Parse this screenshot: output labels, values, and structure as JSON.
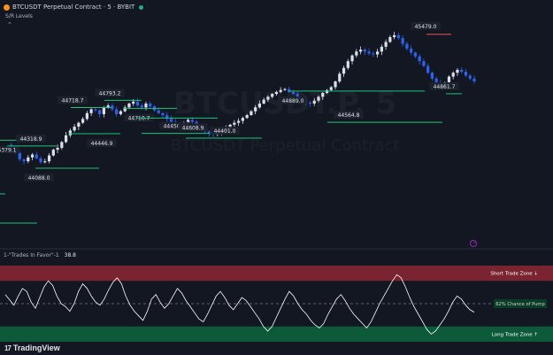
{
  "header": {
    "symbol_title": "BTCUSDT Perpetual Contract · 5 · BYBIT",
    "indicator_name": "S/R Levels"
  },
  "watermark": {
    "line1": "BTCUSDT.P, 5",
    "line2": "BTCUSDT Perpetual Contract"
  },
  "sub_indicator": {
    "name": "1-\"Trades In Favor\"-1",
    "value": "38.8"
  },
  "brand": {
    "name": "TradingView"
  },
  "colors": {
    "background": "#131722",
    "up_candle": "#dbe0f0",
    "down_candle": "#2e62f0",
    "support_line": "#1ec27a",
    "resistance_line": "#ef5350",
    "short_zone": "#7a2331",
    "long_zone": "#0d5a3a",
    "oscillator": "#ffffff"
  },
  "chart_data": {
    "type": "candlestick",
    "price_axis_visible": false,
    "levels": [
      {
        "label": "5379.1",
        "price": 44379.1,
        "kind": "support"
      },
      {
        "label": "44318.9",
        "price": 44318.9,
        "kind": "support"
      },
      {
        "label": "44088.0",
        "price": 44088.0,
        "kind": "support"
      },
      {
        "label": "44718.7",
        "price": 44718.7,
        "kind": "support"
      },
      {
        "label": "44446.9",
        "price": 44446.9,
        "kind": "support"
      },
      {
        "label": "44793.2",
        "price": 44793.2,
        "kind": "support"
      },
      {
        "label": "44710.7",
        "price": 44710.7,
        "kind": "support"
      },
      {
        "label": "44450.3",
        "price": 44450.3,
        "kind": "support"
      },
      {
        "label": "44608.9",
        "price": 44608.9,
        "kind": "support"
      },
      {
        "label": "44401.0",
        "price": 44401.0,
        "kind": "support"
      },
      {
        "label": "44889.0",
        "price": 44889.0,
        "kind": "support"
      },
      {
        "label": "44564.8",
        "price": 44564.8,
        "kind": "support"
      },
      {
        "label": "45479.0",
        "price": 45479.0,
        "kind": "resistance"
      },
      {
        "label": "44861.7",
        "price": 44861.7,
        "kind": "support"
      }
    ],
    "price_path": [
      44330,
      44290,
      44250,
      44180,
      44160,
      44200,
      44230,
      44190,
      44150,
      44160,
      44220,
      44280,
      44300,
      44360,
      44430,
      44480,
      44520,
      44560,
      44600,
      44660,
      44700,
      44690,
      44650,
      44720,
      44740,
      44700,
      44650,
      44680,
      44720,
      44760,
      44780,
      44740,
      44720,
      44760,
      44730,
      44690,
      44660,
      44640,
      44600,
      44570,
      44540,
      44520,
      44560,
      44590,
      44570,
      44540,
      44500,
      44470,
      44450,
      44440,
      44460,
      44480,
      44500,
      44540,
      44560,
      44580,
      44610,
      44640,
      44680,
      44720,
      44760,
      44800,
      44830,
      44860,
      44880,
      44900,
      44910,
      44880,
      44860,
      44820,
      44800,
      44770,
      44760,
      44790,
      44830,
      44870,
      44900,
      44930,
      44990,
      45070,
      45130,
      45200,
      45260,
      45300,
      45320,
      45300,
      45280,
      45270,
      45300,
      45350,
      45400,
      45450,
      45470,
      45440,
      45380,
      45330,
      45290,
      45250,
      45200,
      45150,
      45080,
      45020,
      44970,
      44940,
      44980,
      45040,
      45080,
      45110,
      45090,
      45050,
      45020,
      44990
    ],
    "oscillator": {
      "name": "Trades In Favor",
      "current_value": 38.8,
      "range": [
        0,
        100
      ],
      "zones": [
        {
          "label": "Short Trade Zone ↓",
          "from": 80,
          "to": 100
        },
        {
          "label": "Long Trade Zone ↑",
          "from": 0,
          "to": 20
        }
      ],
      "midline": 50,
      "midline_label": "62% Chance of Pump",
      "values": [
        62,
        55,
        48,
        60,
        70,
        66,
        52,
        44,
        58,
        72,
        80,
        74,
        60,
        50,
        46,
        40,
        50,
        66,
        76,
        70,
        60,
        52,
        48,
        56,
        68,
        78,
        84,
        76,
        60,
        48,
        40,
        34,
        28,
        40,
        56,
        62,
        52,
        44,
        50,
        60,
        70,
        64,
        54,
        46,
        38,
        30,
        26,
        36,
        48,
        60,
        66,
        58,
        48,
        42,
        50,
        58,
        54,
        46,
        38,
        30,
        20,
        14,
        20,
        32,
        44,
        56,
        66,
        60,
        50,
        42,
        36,
        28,
        22,
        18,
        24,
        36,
        46,
        56,
        62,
        54,
        44,
        36,
        30,
        24,
        18,
        26,
        38,
        50,
        60,
        70,
        80,
        88,
        84,
        72,
        58,
        46,
        36,
        26,
        16,
        10,
        14,
        22,
        30,
        40,
        52,
        60,
        56,
        48,
        42,
        38.8
      ]
    }
  }
}
